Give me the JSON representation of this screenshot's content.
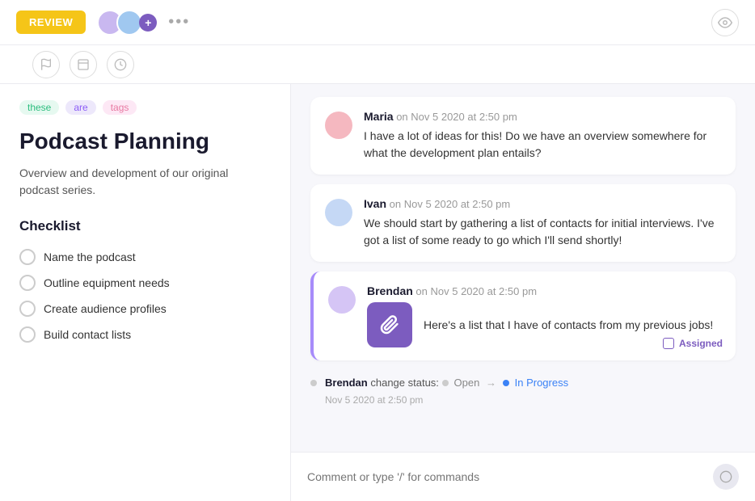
{
  "topbar": {
    "review_label": "REVIEW",
    "three_dots": "•••",
    "eye_icon": "👁"
  },
  "task_toolbar": {
    "flag_icon": "🚩",
    "card_icon": "▭",
    "clock_icon": "⏱"
  },
  "left_panel": {
    "tags": [
      {
        "id": "tag1",
        "label": "these",
        "style": "green"
      },
      {
        "id": "tag2",
        "label": "are",
        "style": "purple"
      },
      {
        "id": "tag3",
        "label": "tags",
        "style": "pink"
      }
    ],
    "title": "Podcast Planning",
    "description": "Overview and development of our original podcast series.",
    "checklist_title": "Checklist",
    "checklist_items": [
      {
        "id": "item1",
        "label": "Name the podcast"
      },
      {
        "id": "item2",
        "label": "Outline equipment needs"
      },
      {
        "id": "item3",
        "label": "Create audience profiles"
      },
      {
        "id": "item4",
        "label": "Build contact lists"
      }
    ]
  },
  "comments": [
    {
      "id": "c1",
      "author": "Maria",
      "timestamp": "on Nov 5 2020 at 2:50 pm",
      "text": "I have a lot of ideas for this! Do we have an overview somewhere for what the development plan entails?",
      "avatar_style": "maria",
      "highlighted": false
    },
    {
      "id": "c2",
      "author": "Ivan",
      "timestamp": "on Nov 5 2020 at 2:50 pm",
      "text": "We should start by gathering a list of contacts for initial interviews. I've got a list of some ready to go which I'll send shortly!",
      "avatar_style": "ivan",
      "highlighted": false
    },
    {
      "id": "c3",
      "author": "Brendan",
      "timestamp": "on Nov 5 2020 at 2:50 pm",
      "text": "Here's a list that I have of contacts from my previous jobs!",
      "avatar_style": "brendan",
      "highlighted": true,
      "has_attachment": true,
      "assigned_label": "Assigned"
    }
  ],
  "status_change": {
    "author": "Brendan",
    "prefix": "change status:",
    "from_status": "Open",
    "arrow": "→",
    "to_status": "In Progress",
    "timestamp": "Nov 5 2020 at 2:50 pm"
  },
  "comment_input": {
    "placeholder": "Comment or type '/' for commands"
  }
}
